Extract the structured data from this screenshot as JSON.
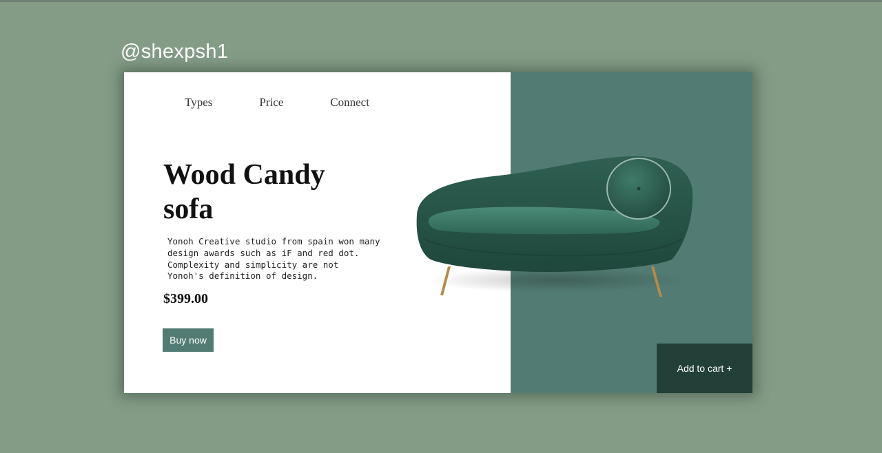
{
  "watermark": "@shexpsh1",
  "nav": {
    "items": [
      "Types",
      "Price",
      "Connect"
    ]
  },
  "product": {
    "title_line1": "Wood Candy",
    "title_line2": "sofa",
    "description_lines": [
      "Yonoh Creative studio from spain won many",
      "design awards such as iF and red dot.",
      "Complexity and simplicity are not",
      "Yonoh's definition of design."
    ],
    "price": "$399.00"
  },
  "buttons": {
    "buy": "Buy now",
    "cart": "Add to cart +"
  },
  "colors": {
    "background": "#849c86",
    "accent": "#527c73",
    "dark_accent": "#223f38",
    "sofa": "#2a5a4d"
  },
  "icons": {
    "product_image": "sofa-image"
  }
}
